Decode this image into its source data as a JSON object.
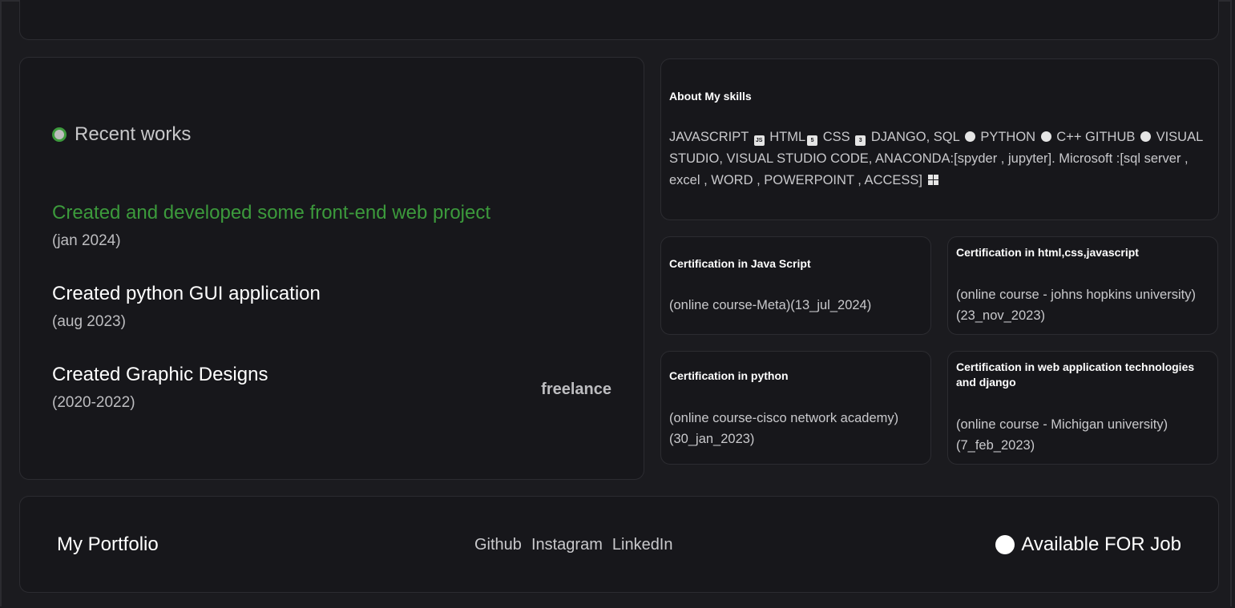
{
  "works": {
    "heading": "Recent works",
    "items": [
      {
        "title": "Created and developed some front-end web project",
        "date": "(jan 2024)"
      },
      {
        "title": "Created python GUI application",
        "date": "(aug 2023)"
      },
      {
        "title": "Created Graphic Designs",
        "date": "(2020-2022)"
      }
    ],
    "tag": "freelance",
    "highlight_color": "#3c9a3c"
  },
  "skills": {
    "title": "About My skills",
    "parts": [
      "JAVASCRIPT",
      " HTML",
      " CSS",
      " DJANGO, SQL",
      " PYTHON",
      " C++ GITHUB",
      " VISUAL STUDIO, VISUAL STUDIO CODE, ANACONDA:[spyder , jupyter]. Microsoft :[sql server , excel , WORD , POWERPOINT , ACCESS]"
    ],
    "icons": [
      "js-icon",
      "html5-icon",
      "css3-icon",
      "database-icon",
      "python-icon",
      "github-icon",
      "windows-icon"
    ]
  },
  "certs": [
    {
      "title": "Certification in Java Script",
      "sub": "(online course-Meta)(13_jul_2024)"
    },
    {
      "title": "Certification in html,css,javascript",
      "sub": "(online course - johns hopkins university)(23_nov_2023)"
    },
    {
      "title": "Certification in python",
      "sub": "(online course-cisco network academy)(30_jan_2023)"
    },
    {
      "title": "Certification in web application technologies and django",
      "sub": "(online course - Michigan university)(7_feb_2023)"
    }
  ],
  "footer": {
    "brand": "My Portfolio",
    "links": [
      "Github",
      "Instagram",
      "LinkedIn"
    ],
    "status": "Available FOR Job"
  }
}
